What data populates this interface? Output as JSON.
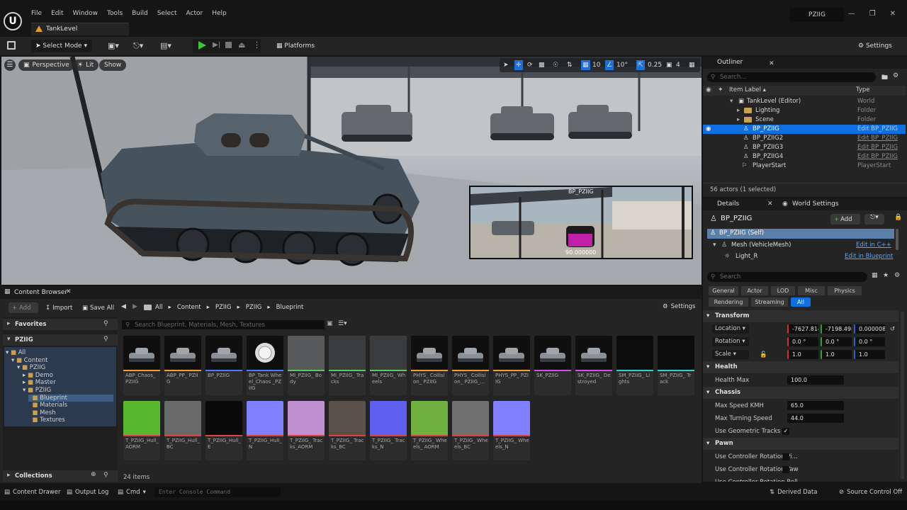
{
  "app": {
    "project_name": "PZIIG",
    "level_tab": "TankLevel",
    "menu": [
      "File",
      "Edit",
      "Window",
      "Tools",
      "Build",
      "Select",
      "Actor",
      "Help"
    ]
  },
  "toolbar": {
    "select_mode": "Select Mode",
    "platforms": "Platforms",
    "settings": "Settings"
  },
  "viewport": {
    "perspective": "Perspective",
    "lit": "Lit",
    "show": "Show",
    "grid_snap": "10",
    "rot_snap": "10°",
    "scale_snap": "0.25",
    "camera_speed": "4",
    "pip_title": "BP_PZIIG",
    "pip_value": "90.000000"
  },
  "outliner": {
    "title": "Outliner",
    "search_placeholder": "Search...",
    "col_label": "Item Label ▴",
    "col_type": "Type",
    "rows": [
      {
        "label": "TankLevel (Editor)",
        "type": "World"
      },
      {
        "label": "Lighting",
        "type": "Folder"
      },
      {
        "label": "Scene",
        "type": "Folder"
      },
      {
        "label": "BP_PZIIG",
        "type": "Edit BP_PZIIG"
      },
      {
        "label": "BP_PZIIG2",
        "type": "Edit BP_PZIIG"
      },
      {
        "label": "BP_PZIIG3",
        "type": "Edit BP_PZIIG"
      },
      {
        "label": "BP_PZIIG4",
        "type": "Edit BP_PZIIG"
      },
      {
        "label": "PlayerStart",
        "type": "PlayerStart"
      }
    ],
    "footer": "56 actors (1 selected)"
  },
  "details": {
    "tab": "Details",
    "tab2": "World Settings",
    "actor_name": "BP_PZIIG",
    "add": "Add",
    "components": [
      {
        "label": "BP_PZIIG (Self)",
        "link": ""
      },
      {
        "label": "Mesh (VehicleMesh)",
        "link": "Edit in C++"
      },
      {
        "label": "Light_R",
        "link": "Edit in Blueprint"
      }
    ],
    "search_placeholder": "Search",
    "filters_row1": [
      "General",
      "Actor",
      "LOD",
      "Misc",
      "Physics"
    ],
    "filters_row2": [
      "Rendering",
      "Streaming",
      "All"
    ],
    "transform": {
      "title": "Transform",
      "location_label": "Location",
      "location": [
        "-7627.8140",
        "-7198.4980",
        "0.000008"
      ],
      "rotation_label": "Rotation",
      "rotation": [
        "0.0 °",
        "0.0 °",
        "0.0 °"
      ],
      "scale_label": "Scale",
      "scale": [
        "1.0",
        "1.0",
        "1.0"
      ]
    },
    "health": {
      "title": "Health",
      "max_label": "Health Max",
      "max_value": "100.0"
    },
    "chassis": {
      "title": "Chassis",
      "speed_label": "Max Speed KMH",
      "speed_value": "65.0",
      "turn_label": "Max Turning Speed",
      "turn_value": "44.0",
      "geo_label": "Use Geometric Tracks"
    },
    "pawn": {
      "title": "Pawn",
      "pitch_label": "Use Controller Rotation Pi...",
      "yaw_label": "Use Controller Rotation Yaw",
      "roll_label": "Use Controller Rotation Roll"
    }
  },
  "content_browser": {
    "tab": "Content Browser",
    "add": "Add",
    "import": "Import",
    "save_all": "Save All",
    "breadcrumbs": [
      "All",
      "Content",
      "PZIIG",
      "PZIIG",
      "Blueprint"
    ],
    "settings": "Settings",
    "favorites": "Favorites",
    "project_root": "PZIIG",
    "tree": [
      "All",
      "Content",
      "PZIIG",
      "Demo",
      "Master",
      "PZIIG",
      "Blueprint",
      "Materials",
      "Mesh",
      "Textures"
    ],
    "collections": "Collections",
    "search_placeholder": "Search Blueprint, Materials, Mesh, Textures",
    "item_count": "24 items",
    "assets_row1": [
      {
        "name": "ABP_Chaos_ PZIIG",
        "color": "#f0a030"
      },
      {
        "name": "ABP_PP_ PZIIG",
        "color": "#f0a030"
      },
      {
        "name": "BP_PZIIG",
        "color": "#4a7cff"
      },
      {
        "name": "BP_Tank Wheel_Chaos _PZIIG",
        "color": "#4a7cff"
      },
      {
        "name": "MI_PZIIG_ Body",
        "color": "#5ac85a"
      },
      {
        "name": "MI_PZIIG_ Tracks",
        "color": "#5ac85a"
      },
      {
        "name": "MI_PZIIG_ Wheels",
        "color": "#5ac85a"
      },
      {
        "name": "PHYS_ Collision_ PZIIG",
        "color": "#f0a030"
      },
      {
        "name": "PHYS_ Collision_ PZIIG_...",
        "color": "#f0a030"
      },
      {
        "name": "PHYS_PP_ PZIIG",
        "color": "#f0a030"
      },
      {
        "name": "SK_PZIIG",
        "color": "#d050e0"
      },
      {
        "name": "SK_PZIIG_ Destroyed",
        "color": "#d050e0"
      },
      {
        "name": "SM_PZIIG_ Lights",
        "color": "#30d0d0"
      },
      {
        "name": "SM_PZIIG_ Track",
        "color": "#30d0d0"
      }
    ],
    "assets_row2": [
      {
        "name": "T_PZIIG_Hull_ AORM",
        "color": "#e04040"
      },
      {
        "name": "T_PZIIG_Hull_ BC",
        "color": "#e04040"
      },
      {
        "name": "T_PZIIG_Hull_ E",
        "color": "#e04040"
      },
      {
        "name": "T_PZIIG_Hull_ N",
        "color": "#e04040"
      },
      {
        "name": "T_PZIIG_ Tracks_AORM",
        "color": "#e04040"
      },
      {
        "name": "T_PZIIG_ Tracks_BC",
        "color": "#e04040"
      },
      {
        "name": "T_PZIIG_ Tracks_N",
        "color": "#e04040"
      },
      {
        "name": "T_PZIIG_ Wheels_ AORM",
        "color": "#e04040"
      },
      {
        "name": "T_PZIIG_ Wheels_BC",
        "color": "#e04040"
      },
      {
        "name": "T_PZIIG_ Wheels_N",
        "color": "#e04040"
      }
    ]
  },
  "statusbar": {
    "content_drawer": "Content Drawer",
    "output_log": "Output Log",
    "cmd": "Cmd",
    "console_placeholder": "Enter Console Command",
    "derived_data": "Derived Data",
    "source_control": "Source Control Off"
  }
}
